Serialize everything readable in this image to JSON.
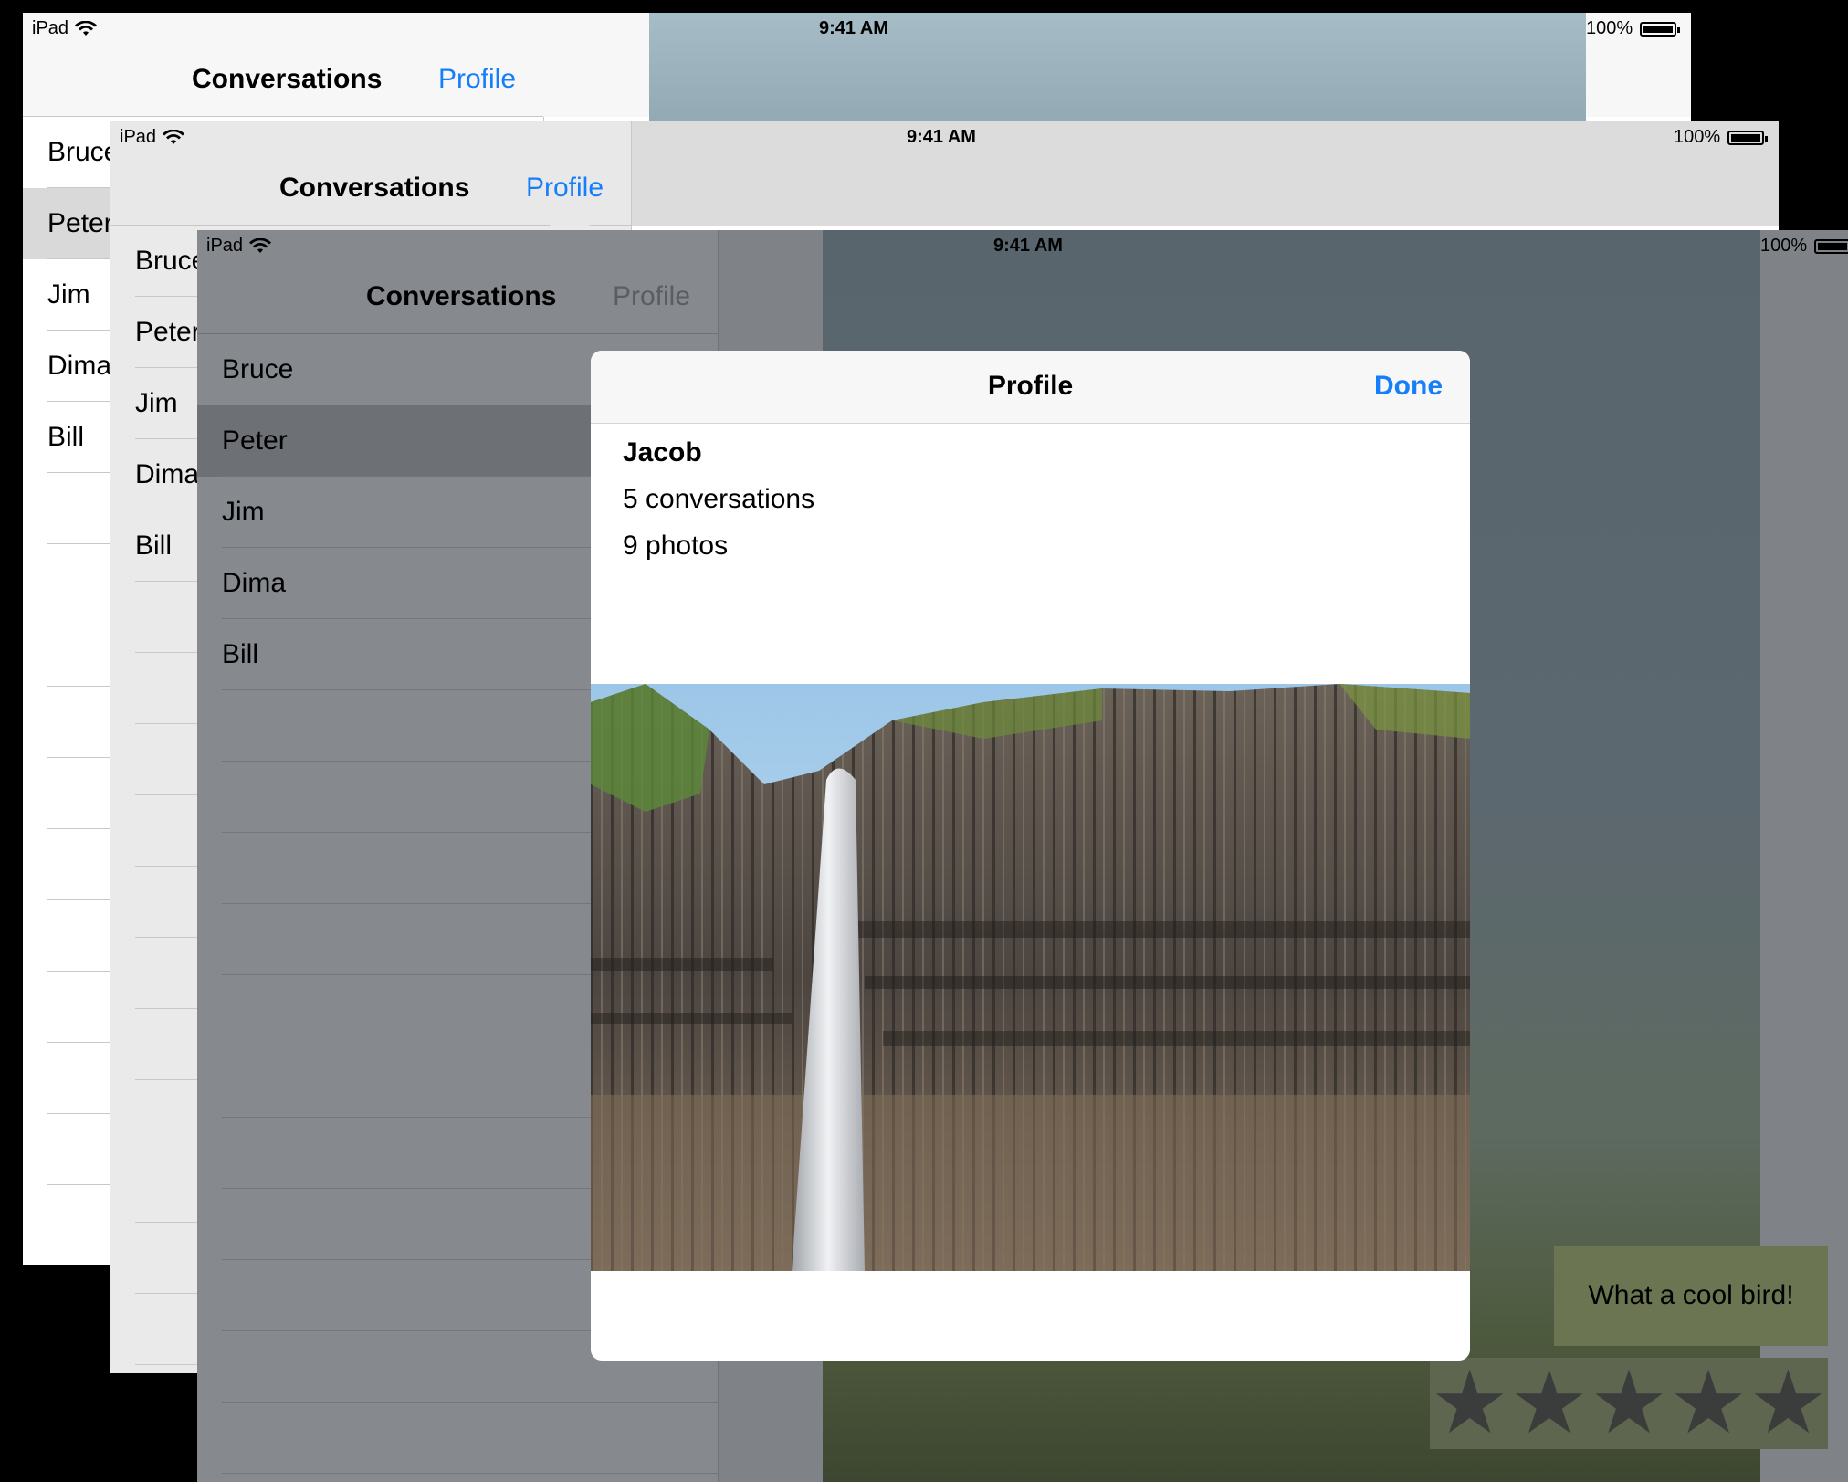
{
  "status_bar": {
    "device": "iPad",
    "time": "9:41 AM",
    "battery": "100%"
  },
  "sidebar": {
    "title": "Conversations",
    "profile_button": "Profile",
    "items": [
      {
        "label": "Bruce"
      },
      {
        "label": "Peter"
      },
      {
        "label": "Jim"
      },
      {
        "label": "Dima"
      },
      {
        "label": "Bill"
      }
    ]
  },
  "modal": {
    "title": "Profile",
    "done_label": "Done",
    "name": "Jacob",
    "conversations": "5 conversations",
    "photos": "9 photos"
  },
  "chat": {
    "bubble_text": "What a cool bird!",
    "rating": 5
  },
  "colors": {
    "accent": "#157efb",
    "dim_overlay": "#868a8e"
  }
}
